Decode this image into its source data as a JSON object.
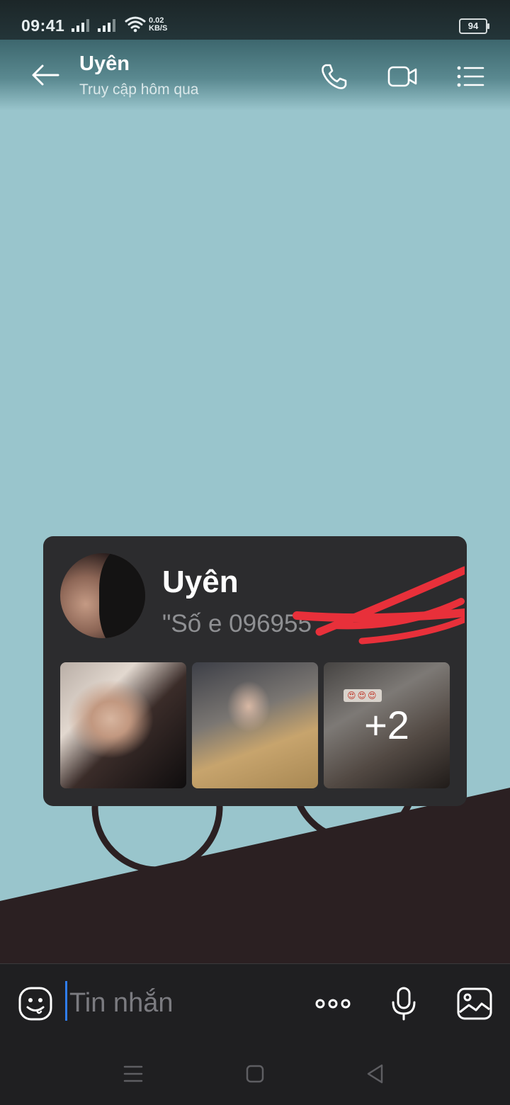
{
  "status_bar": {
    "time": "09:41",
    "net_speed_value": "0.02",
    "net_speed_unit": "KB/S",
    "battery": "94"
  },
  "header": {
    "contact_name": "Uyên",
    "last_seen": "Truy cập hôm qua",
    "icons": [
      "back-arrow-icon",
      "phone-icon",
      "video-call-icon",
      "list-menu-icon"
    ]
  },
  "card": {
    "name": "Uyên",
    "note": "\"Số e 096955",
    "more_photos": "+2",
    "emoji_strip": "😍😍😍"
  },
  "composer": {
    "placeholder": "Tin nhắn",
    "icons": [
      "sticker-icon",
      "more-dots-icon",
      "microphone-icon",
      "image-icon"
    ]
  },
  "colors": {
    "chat_background": "#99c5cc",
    "card_background": "#2c2c2e",
    "cursor": "#2f7df0",
    "redaction": "#e8303a"
  }
}
